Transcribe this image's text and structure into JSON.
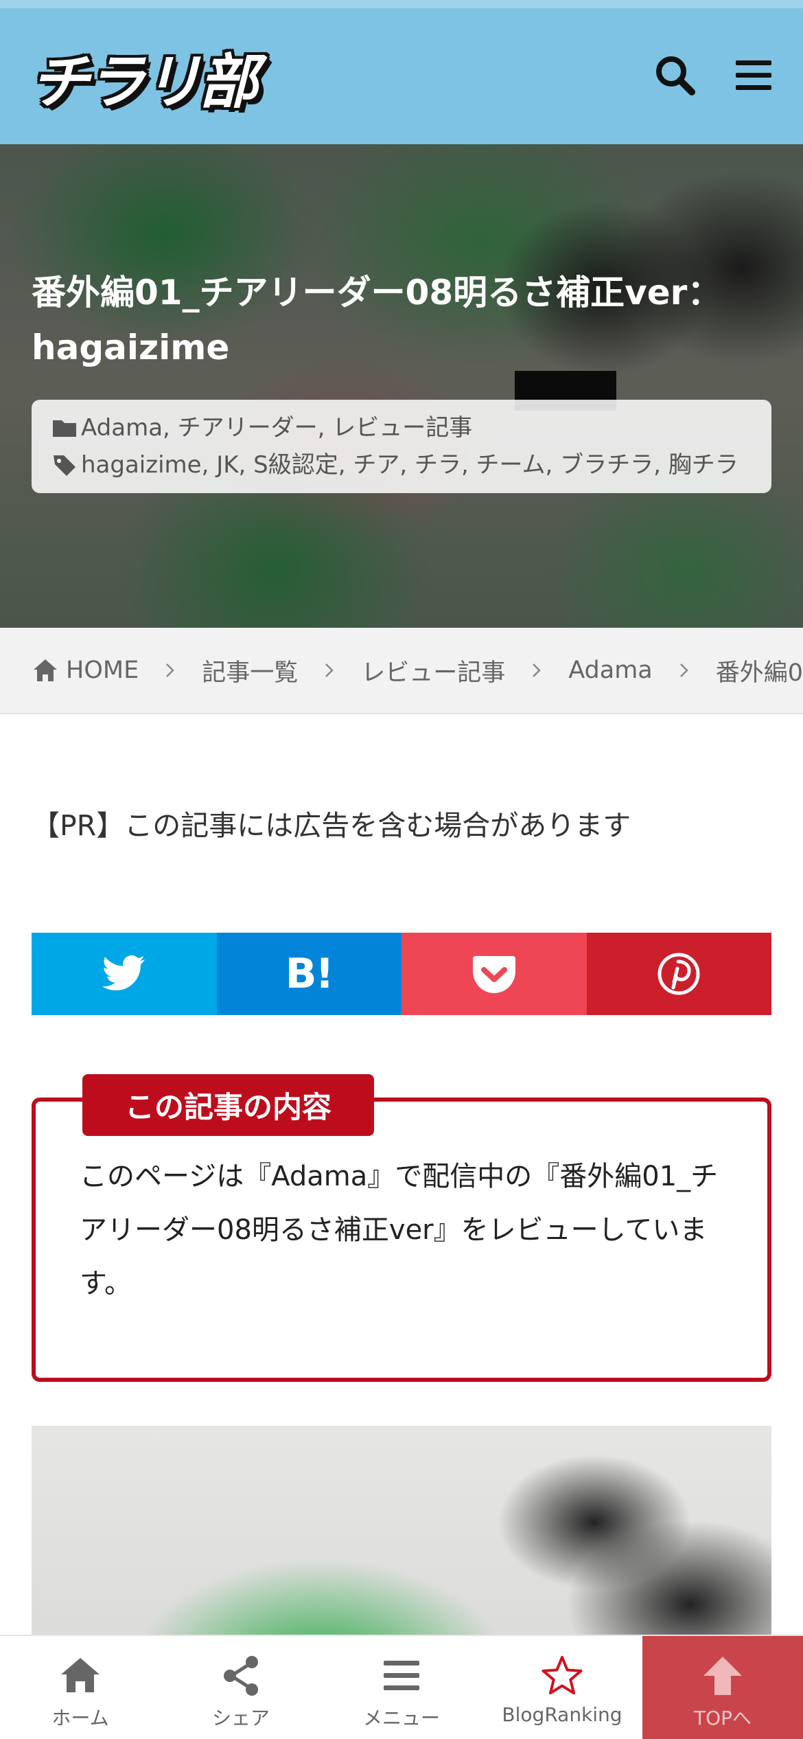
{
  "header": {
    "logo_text": "チラリ部",
    "colors": {
      "bar": "#7ec3e3",
      "accent": "#bd0d1d"
    }
  },
  "hero": {
    "title": "番外編01_チアリーダー08明るさ補正ver：hagaizime",
    "categories": "Adama, チアリーダー, レビュー記事",
    "tags": "hagaizime, JK, S級認定, チア, チラ, チーム, ブラチラ, 胸チラ"
  },
  "breadcrumb": {
    "items": [
      "HOME",
      "記事一覧",
      "レビュー記事",
      "Adama",
      "番外編0"
    ]
  },
  "notice": "【PR】この記事には広告を含む場合があります",
  "share": {
    "buttons": [
      "twitter-icon",
      "hatena-bookmark-icon",
      "pocket-icon",
      "pinterest-icon"
    ],
    "hatena_label": "B!"
  },
  "summary": {
    "heading": "この記事の内容",
    "text": "このページは『Adama』で配信中の『番外編01_チアリーダー08明るさ補正ver』をレビューしています。"
  },
  "bottom_nav": {
    "items": [
      {
        "label": "ホーム",
        "icon": "home-icon"
      },
      {
        "label": "シェア",
        "icon": "share-icon"
      },
      {
        "label": "メニュー",
        "icon": "menu-icon"
      },
      {
        "label": "BlogRanking",
        "icon": "star-icon"
      },
      {
        "label": "TOPへ",
        "icon": "arrow-up-icon"
      }
    ]
  }
}
